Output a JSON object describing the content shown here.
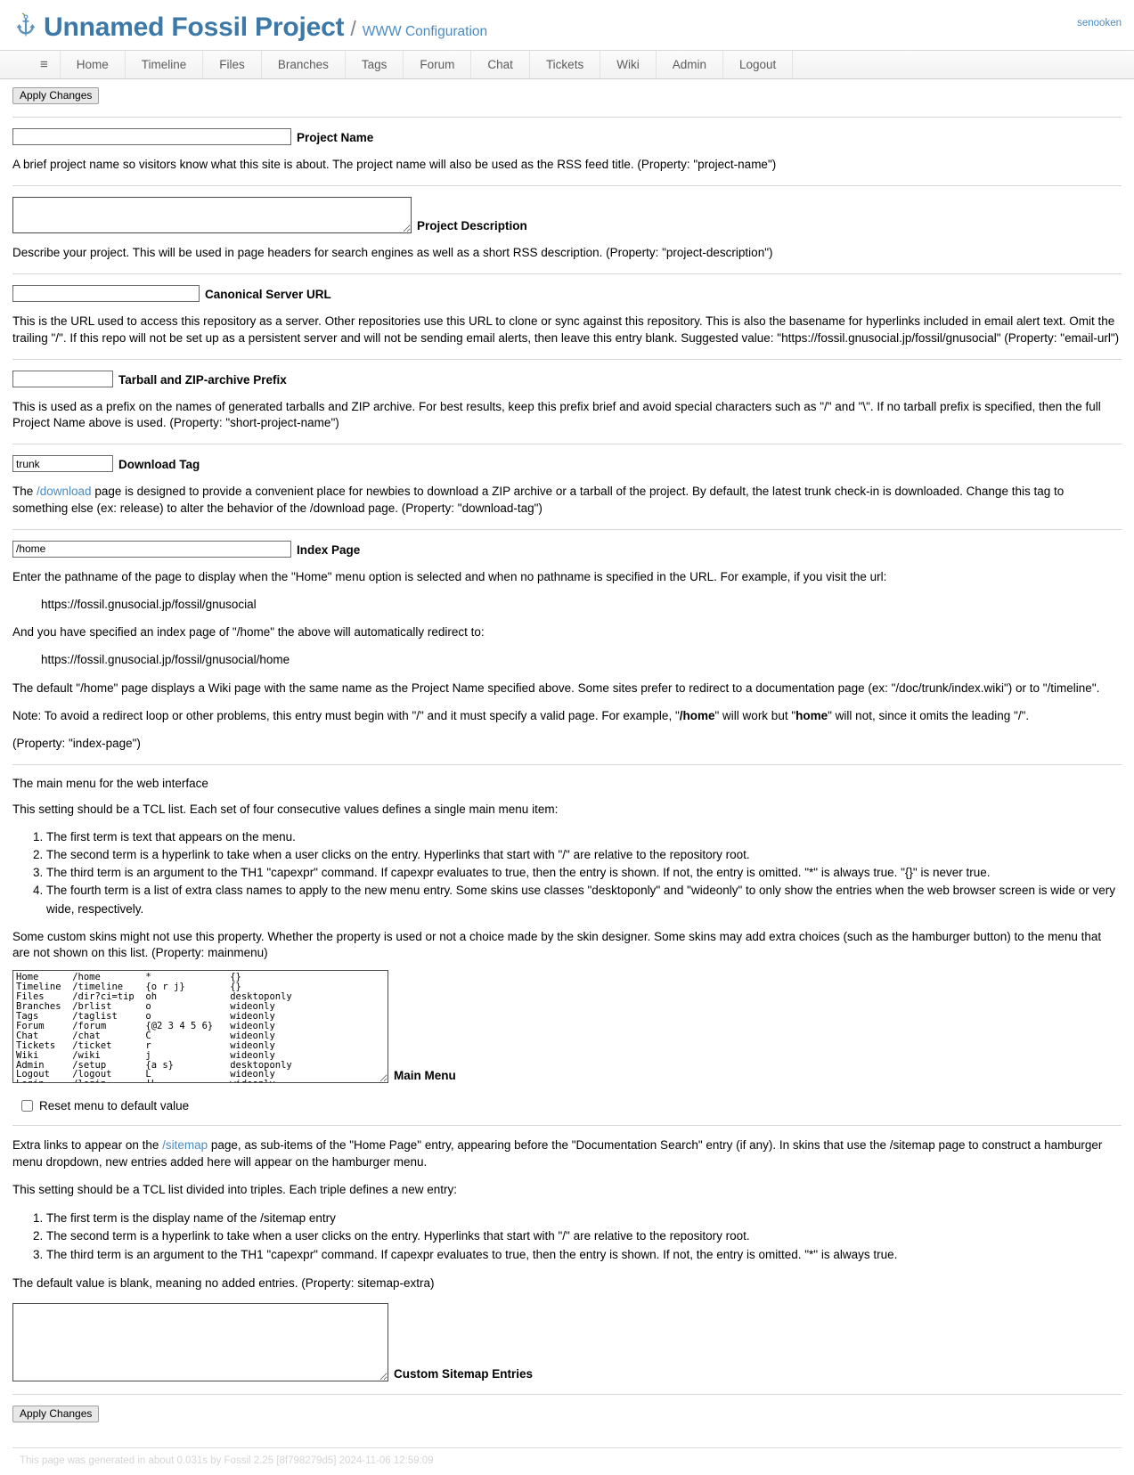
{
  "header": {
    "project_title": "Unnamed Fossil Project",
    "separator": "/",
    "subtitle": "WWW Configuration",
    "user": "senooken",
    "logo_icon": "fossil-anchor-icon"
  },
  "mainmenu": {
    "hamburger": "≡",
    "items": [
      {
        "label": "Home"
      },
      {
        "label": "Timeline"
      },
      {
        "label": "Files"
      },
      {
        "label": "Branches"
      },
      {
        "label": "Tags"
      },
      {
        "label": "Forum"
      },
      {
        "label": "Chat"
      },
      {
        "label": "Tickets"
      },
      {
        "label": "Wiki"
      },
      {
        "label": "Admin"
      },
      {
        "label": "Logout"
      }
    ]
  },
  "toolbar": {
    "apply_top": "Apply Changes",
    "apply_bottom": "Apply Changes"
  },
  "fields": {
    "project_name": {
      "label": "Project Name",
      "value": "",
      "help": "A brief project name so visitors know what this site is about. The project name will also be used as the RSS feed title. (Property: \"project-name\")"
    },
    "project_description": {
      "label": "Project Description",
      "value": "",
      "help": "Describe your project. This will be used in page headers for search engines as well as a short RSS description. (Property: \"project-description\")"
    },
    "canonical_server_url": {
      "label": "Canonical Server URL",
      "value": "",
      "help": "This is the URL used to access this repository as a server. Other repositories use this URL to clone or sync against this repository. This is also the basename for hyperlinks included in email alert text. Omit the trailing \"/\". If this repo will not be set up as a persistent server and will not be sending email alerts, then leave this entry blank. Suggested value: \"https://fossil.gnusocial.jp/fossil/gnusocial\" (Property: \"email-url\")"
    },
    "tarball_prefix": {
      "label": "Tarball and ZIP-archive Prefix",
      "value": "",
      "help": "This is used as a prefix on the names of generated tarballs and ZIP archive. For best results, keep this prefix brief and avoid special characters such as \"/\" and \"\\\". If no tarball prefix is specified, then the full Project Name above is used. (Property: \"short-project-name\")"
    },
    "download_tag": {
      "label": "Download Tag",
      "value": "trunk",
      "help_pre": "The ",
      "help_link": "/download",
      "help_post": " page is designed to provide a convenient place for newbies to download a ZIP archive or a tarball of the project. By default, the latest trunk check-in is downloaded. Change this tag to something else (ex: release) to alter the behavior of the /download page. (Property: \"download-tag\")"
    },
    "index_page": {
      "label": "Index Page",
      "value": "/home",
      "help_1": "Enter the pathname of the page to display when the \"Home\" menu option is selected and when no pathname is specified in the URL. For example, if you visit the url:",
      "example_url_1": "https://fossil.gnusocial.jp/fossil/gnusocial",
      "help_2": "And you have specified an index page of \"/home\" the above will automatically redirect to:",
      "example_url_2": "https://fossil.gnusocial.jp/fossil/gnusocial/home",
      "help_3": "The default \"/home\" page displays a Wiki page with the same name as the Project Name specified above. Some sites prefer to redirect to a documentation page (ex: \"/doc/trunk/index.wiki\") or to \"/timeline\".",
      "note_pre": "Note: To avoid a redirect loop or other problems, this entry must begin with \"/\" and it must specify a valid page. For example, \"",
      "note_bold_1": "/home",
      "note_mid": "\" will work but \"",
      "note_bold_2": "home",
      "note_post": "\" will not, since it omits the leading \"/\".",
      "property_line": "(Property: \"index-page\")"
    },
    "main_menu": {
      "label": "Main Menu",
      "intro": "The main menu for the web interface",
      "tcl_note": "This setting should be a TCL list. Each set of four consecutive values defines a single main menu item:",
      "terms": [
        "The first term is text that appears on the menu.",
        "The second term is a hyperlink to take when a user clicks on the entry. Hyperlinks that start with \"/\" are relative to the repository root.",
        "The third term is an argument to the TH1 \"capexpr\" command. If capexpr evaluates to true, then the entry is shown. If not, the entry is omitted. \"*\" is always true. \"{}\" is never true.",
        "The fourth term is a list of extra class names to apply to the new menu entry. Some skins use classes \"desktoponly\" and \"wideonly\" to only show the entries when the web browser screen is wide or very wide, respectively."
      ],
      "skins_note": "Some custom skins might not use this property. Whether the property is used or not a choice made by the skin designer. Some skins may add extra choices (such as the hamburger button) to the menu that are not shown on this list. (Property: mainmenu)",
      "value": "Home      /home        *              {}\nTimeline  /timeline    {o r j}        {}\nFiles     /dir?ci=tip  oh             desktoponly\nBranches  /brlist      o              wideonly\nTags      /taglist     o              wideonly\nForum     /forum       {@2 3 4 5 6}   wideonly\nChat      /chat        C              wideonly\nTickets   /ticket      r              wideonly\nWiki      /wiki        j              wideonly\nAdmin     /setup       {a s}          desktoponly\nLogout    /logout      L              wideonly\nLogin     /login       !L             wideonly",
      "reset_checkbox_label": "Reset menu to default value",
      "reset_checked": false
    },
    "sitemap_extra": {
      "label": "Custom Sitemap Entries",
      "value": "",
      "help_pre": "Extra links to appear on the ",
      "help_link": "/sitemap",
      "help_post": " page, as sub-items of the \"Home Page\" entry, appearing before the \"Documentation Search\" entry (if any). In skins that use the /sitemap page to construct a hamburger menu dropdown, new entries added here will appear on the hamburger menu.",
      "tcl_note": "This setting should be a TCL list divided into triples. Each triple defines a new entry:",
      "terms": [
        "The first term is the display name of the /sitemap entry",
        "The second term is a hyperlink to take when a user clicks on the entry. Hyperlinks that start with \"/\" are relative to the repository root.",
        "The third term is an argument to the TH1 \"capexpr\" command. If capexpr evaluates to true, then the entry is shown. If not, the entry is omitted. \"*\" is always true."
      ],
      "default_note": "The default value is blank, meaning no added entries. (Property: sitemap-extra)"
    }
  },
  "footer": {
    "text": "This page was generated in about 0.031s by Fossil 2.25 [8f798279d5] 2024-11-06 12:59:09"
  },
  "colors": {
    "brand_blue": "#3c78a8",
    "link_blue": "#4a8bc2",
    "menu_text": "#5c5c5c",
    "footer_text": "#d5d5d5"
  }
}
